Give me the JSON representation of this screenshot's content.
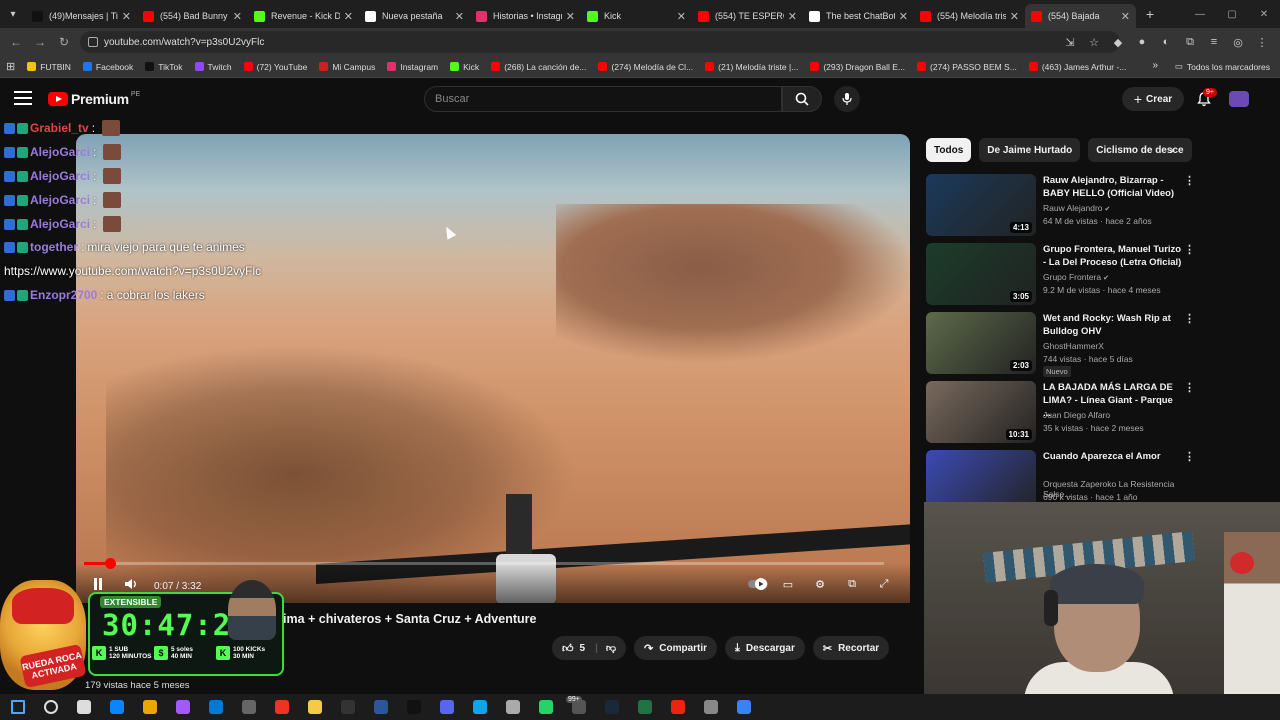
{
  "browser": {
    "tabs": [
      {
        "title": "(49)Mensajes | Tik",
        "color": "#111111",
        "active": false
      },
      {
        "title": "(554) Bad Bunny",
        "color": "#ff0000",
        "active": false
      },
      {
        "title": "Revenue - Kick D",
        "color": "#53fc18",
        "active": false
      },
      {
        "title": "Nueva pestaña",
        "color": "#ffffff",
        "active": false
      },
      {
        "title": "Historias • Instagr",
        "color": "#e1306c",
        "active": false
      },
      {
        "title": "Kick",
        "color": "#53fc18",
        "active": false
      },
      {
        "title": "(554) TE ESPERO",
        "color": "#ff0000",
        "active": false
      },
      {
        "title": "The best ChatBot",
        "color": "#ffffff",
        "active": false
      },
      {
        "title": "(554) Melodía tris",
        "color": "#ff0000",
        "active": false
      },
      {
        "title": "(554) Bajada",
        "color": "#ff0000",
        "active": true
      }
    ],
    "url": "youtube.com/watch?v=p3s0U2vyFlc",
    "bookmarks": [
      {
        "label": "FUTBIN",
        "color": "#f5c400"
      },
      {
        "label": "Facebook",
        "color": "#1877f2"
      },
      {
        "label": "TikTok",
        "color": "#111111"
      },
      {
        "label": "Twitch",
        "color": "#9146ff"
      },
      {
        "label": "(72) YouTube",
        "color": "#ff0000"
      },
      {
        "label": "Mi Campus",
        "color": "#cc1f1f"
      },
      {
        "label": "Instagram",
        "color": "#e1306c"
      },
      {
        "label": "Kick",
        "color": "#53fc18"
      },
      {
        "label": "(268) La canción de...",
        "color": "#ff0000"
      },
      {
        "label": "(274) Melodía de Cl...",
        "color": "#ff0000"
      },
      {
        "label": "(21) Melodía triste |...",
        "color": "#ff0000"
      },
      {
        "label": "(293) Dragon Ball E...",
        "color": "#ff0000"
      },
      {
        "label": "(274) PASSO BEM S...",
        "color": "#ff0000"
      },
      {
        "label": "(463) James Arthur -...",
        "color": "#ff0000"
      }
    ],
    "all_bookmarks": "Todos los marcadores"
  },
  "youtube": {
    "logo": "Premium",
    "logo_region": "PE",
    "search_placeholder": "Buscar",
    "create_label": "Crear",
    "notif_badge": "9+",
    "player": {
      "time": "0:07 / 3:32",
      "progress_fraction": 0.033
    },
    "video_title": "ima + chivateros + Santa Cruz + Adventure",
    "likes": "5",
    "share_label": "Compartir",
    "download_label": "Descargar",
    "clip_label": "Recortar",
    "views_meta": "179 vistas  hace 5 meses",
    "chips": [
      "Todos",
      "De Jaime Hurtado",
      "Ciclismo de desce"
    ],
    "recommendations": [
      {
        "title": "Rauw Alejandro, Bizarrap - BABY HELLO (Official Video)",
        "channel": "Rauw Alejandro",
        "verified": true,
        "meta": "64 M de vistas · hace 2 años",
        "duration": "4:13",
        "thumb_color": "#1b3a5c",
        "new": ""
      },
      {
        "title": "Grupo Frontera, Manuel Turizo - La Del Proceso (Letra Oficial)",
        "channel": "Grupo Frontera",
        "verified": true,
        "meta": "9.2 M de vistas · hace 4 meses",
        "duration": "3:05",
        "thumb_color": "#1a3d2a",
        "new": ""
      },
      {
        "title": "Wet and Rocky: Wash Rip at Bulldog OHV",
        "channel": "GhostHammerX",
        "verified": false,
        "meta": "744 vistas · hace 5 días",
        "duration": "2:03",
        "thumb_color": "#5d6b4a",
        "new": "Nuevo"
      },
      {
        "title": "LA BAJADA MÁS LARGA DE LIMA? - Línea Giant - Parque ...",
        "channel": "Juan Diego Alfaro",
        "verified": false,
        "meta": "35 k vistas · hace 2 meses",
        "duration": "10:31",
        "thumb_color": "#7a6a5d",
        "new": ""
      },
      {
        "title": "Cuando Aparezca el Amor",
        "channel": "Orquesta Zaperoko La Resistencia Salse...",
        "verified": false,
        "meta": "690 k vistas · hace 1 año",
        "duration": "",
        "thumb_color": "#3b4bb5",
        "new": ""
      }
    ]
  },
  "stream_overlay": {
    "chat": [
      {
        "user": "Grabiel_tv",
        "sep": ":",
        "msg": "",
        "user_color": "#e04545"
      },
      {
        "user": "AlejoGarci",
        "sep": ":",
        "msg": "",
        "user_color": "#9a7bde"
      },
      {
        "user": "AlejoGarci",
        "sep": ":",
        "msg": "",
        "user_color": "#9a7bde"
      },
      {
        "user": "AlejoGarci",
        "sep": ":",
        "msg": "",
        "user_color": "#9a7bde"
      },
      {
        "user": "AlejoGarci",
        "sep": ":",
        "msg": "",
        "user_color": "#9a7bde"
      },
      {
        "user": "together",
        "sep": ":",
        "msg": "mira viejo para que te animes",
        "user_color": "#9a7bde"
      },
      {
        "user": "",
        "sep": "",
        "msg": "https://www.youtube.com/watch?v=p3s0U2vyFlc",
        "user_color": "#ffffff"
      },
      {
        "user": "Enzopr2700",
        "sep": ":",
        "msg": "a cobrar los lakers",
        "user_color": "#9a7bde"
      }
    ],
    "timer": {
      "extensible": "EXTENSIBLE",
      "count": "30:47:22",
      "activada": "RUEDA ROCA ACTIVADA",
      "rewards": [
        {
          "badge": "K",
          "line1": "1 SUB",
          "line2": "120 MINUTOS"
        },
        {
          "badge": "$",
          "line1": "5 soles",
          "line2": "40 MIN"
        },
        {
          "badge": "K",
          "line1": "100 KICKs",
          "line2": "30 MIN"
        }
      ]
    }
  },
  "taskbar": {
    "badge": "99+",
    "icons": [
      "start-icon",
      "search-icon",
      "task-view-icon",
      "edge-icon",
      "chrome-icon",
      "figma-icon",
      "outlook-icon",
      "app-icon",
      "youtube-icon",
      "files-icon",
      "obs-icon",
      "word-icon",
      "capcut-icon",
      "discord-icon",
      "notes-icon",
      "chatgpt-icon",
      "whatsapp-icon",
      "calculator-icon",
      "steam-icon",
      "excel-icon",
      "acrobat-icon",
      "app2-icon",
      "app3-icon"
    ]
  }
}
